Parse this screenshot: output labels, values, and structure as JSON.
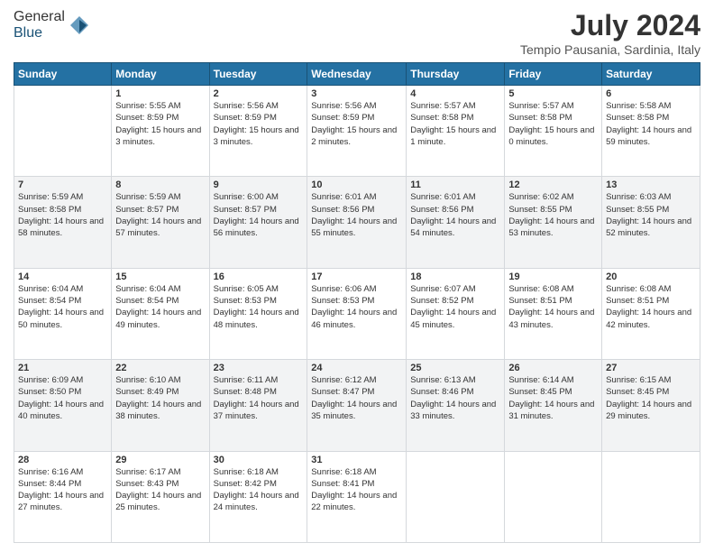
{
  "logo": {
    "general": "General",
    "blue": "Blue"
  },
  "header": {
    "month_year": "July 2024",
    "location": "Tempio Pausania, Sardinia, Italy"
  },
  "days_of_week": [
    "Sunday",
    "Monday",
    "Tuesday",
    "Wednesday",
    "Thursday",
    "Friday",
    "Saturday"
  ],
  "weeks": [
    [
      {
        "day": "",
        "sunrise": "",
        "sunset": "",
        "daylight": ""
      },
      {
        "day": "1",
        "sunrise": "Sunrise: 5:55 AM",
        "sunset": "Sunset: 8:59 PM",
        "daylight": "Daylight: 15 hours and 3 minutes."
      },
      {
        "day": "2",
        "sunrise": "Sunrise: 5:56 AM",
        "sunset": "Sunset: 8:59 PM",
        "daylight": "Daylight: 15 hours and 3 minutes."
      },
      {
        "day": "3",
        "sunrise": "Sunrise: 5:56 AM",
        "sunset": "Sunset: 8:59 PM",
        "daylight": "Daylight: 15 hours and 2 minutes."
      },
      {
        "day": "4",
        "sunrise": "Sunrise: 5:57 AM",
        "sunset": "Sunset: 8:58 PM",
        "daylight": "Daylight: 15 hours and 1 minute."
      },
      {
        "day": "5",
        "sunrise": "Sunrise: 5:57 AM",
        "sunset": "Sunset: 8:58 PM",
        "daylight": "Daylight: 15 hours and 0 minutes."
      },
      {
        "day": "6",
        "sunrise": "Sunrise: 5:58 AM",
        "sunset": "Sunset: 8:58 PM",
        "daylight": "Daylight: 14 hours and 59 minutes."
      }
    ],
    [
      {
        "day": "7",
        "sunrise": "Sunrise: 5:59 AM",
        "sunset": "Sunset: 8:58 PM",
        "daylight": "Daylight: 14 hours and 58 minutes."
      },
      {
        "day": "8",
        "sunrise": "Sunrise: 5:59 AM",
        "sunset": "Sunset: 8:57 PM",
        "daylight": "Daylight: 14 hours and 57 minutes."
      },
      {
        "day": "9",
        "sunrise": "Sunrise: 6:00 AM",
        "sunset": "Sunset: 8:57 PM",
        "daylight": "Daylight: 14 hours and 56 minutes."
      },
      {
        "day": "10",
        "sunrise": "Sunrise: 6:01 AM",
        "sunset": "Sunset: 8:56 PM",
        "daylight": "Daylight: 14 hours and 55 minutes."
      },
      {
        "day": "11",
        "sunrise": "Sunrise: 6:01 AM",
        "sunset": "Sunset: 8:56 PM",
        "daylight": "Daylight: 14 hours and 54 minutes."
      },
      {
        "day": "12",
        "sunrise": "Sunrise: 6:02 AM",
        "sunset": "Sunset: 8:55 PM",
        "daylight": "Daylight: 14 hours and 53 minutes."
      },
      {
        "day": "13",
        "sunrise": "Sunrise: 6:03 AM",
        "sunset": "Sunset: 8:55 PM",
        "daylight": "Daylight: 14 hours and 52 minutes."
      }
    ],
    [
      {
        "day": "14",
        "sunrise": "Sunrise: 6:04 AM",
        "sunset": "Sunset: 8:54 PM",
        "daylight": "Daylight: 14 hours and 50 minutes."
      },
      {
        "day": "15",
        "sunrise": "Sunrise: 6:04 AM",
        "sunset": "Sunset: 8:54 PM",
        "daylight": "Daylight: 14 hours and 49 minutes."
      },
      {
        "day": "16",
        "sunrise": "Sunrise: 6:05 AM",
        "sunset": "Sunset: 8:53 PM",
        "daylight": "Daylight: 14 hours and 48 minutes."
      },
      {
        "day": "17",
        "sunrise": "Sunrise: 6:06 AM",
        "sunset": "Sunset: 8:53 PM",
        "daylight": "Daylight: 14 hours and 46 minutes."
      },
      {
        "day": "18",
        "sunrise": "Sunrise: 6:07 AM",
        "sunset": "Sunset: 8:52 PM",
        "daylight": "Daylight: 14 hours and 45 minutes."
      },
      {
        "day": "19",
        "sunrise": "Sunrise: 6:08 AM",
        "sunset": "Sunset: 8:51 PM",
        "daylight": "Daylight: 14 hours and 43 minutes."
      },
      {
        "day": "20",
        "sunrise": "Sunrise: 6:08 AM",
        "sunset": "Sunset: 8:51 PM",
        "daylight": "Daylight: 14 hours and 42 minutes."
      }
    ],
    [
      {
        "day": "21",
        "sunrise": "Sunrise: 6:09 AM",
        "sunset": "Sunset: 8:50 PM",
        "daylight": "Daylight: 14 hours and 40 minutes."
      },
      {
        "day": "22",
        "sunrise": "Sunrise: 6:10 AM",
        "sunset": "Sunset: 8:49 PM",
        "daylight": "Daylight: 14 hours and 38 minutes."
      },
      {
        "day": "23",
        "sunrise": "Sunrise: 6:11 AM",
        "sunset": "Sunset: 8:48 PM",
        "daylight": "Daylight: 14 hours and 37 minutes."
      },
      {
        "day": "24",
        "sunrise": "Sunrise: 6:12 AM",
        "sunset": "Sunset: 8:47 PM",
        "daylight": "Daylight: 14 hours and 35 minutes."
      },
      {
        "day": "25",
        "sunrise": "Sunrise: 6:13 AM",
        "sunset": "Sunset: 8:46 PM",
        "daylight": "Daylight: 14 hours and 33 minutes."
      },
      {
        "day": "26",
        "sunrise": "Sunrise: 6:14 AM",
        "sunset": "Sunset: 8:45 PM",
        "daylight": "Daylight: 14 hours and 31 minutes."
      },
      {
        "day": "27",
        "sunrise": "Sunrise: 6:15 AM",
        "sunset": "Sunset: 8:45 PM",
        "daylight": "Daylight: 14 hours and 29 minutes."
      }
    ],
    [
      {
        "day": "28",
        "sunrise": "Sunrise: 6:16 AM",
        "sunset": "Sunset: 8:44 PM",
        "daylight": "Daylight: 14 hours and 27 minutes."
      },
      {
        "day": "29",
        "sunrise": "Sunrise: 6:17 AM",
        "sunset": "Sunset: 8:43 PM",
        "daylight": "Daylight: 14 hours and 25 minutes."
      },
      {
        "day": "30",
        "sunrise": "Sunrise: 6:18 AM",
        "sunset": "Sunset: 8:42 PM",
        "daylight": "Daylight: 14 hours and 24 minutes."
      },
      {
        "day": "31",
        "sunrise": "Sunrise: 6:18 AM",
        "sunset": "Sunset: 8:41 PM",
        "daylight": "Daylight: 14 hours and 22 minutes."
      },
      {
        "day": "",
        "sunrise": "",
        "sunset": "",
        "daylight": ""
      },
      {
        "day": "",
        "sunrise": "",
        "sunset": "",
        "daylight": ""
      },
      {
        "day": "",
        "sunrise": "",
        "sunset": "",
        "daylight": ""
      }
    ]
  ]
}
